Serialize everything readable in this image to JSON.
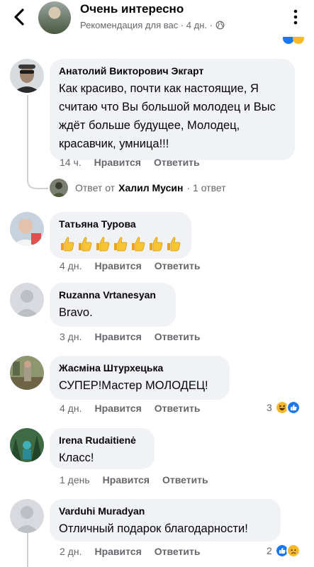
{
  "header": {
    "page_name": "Очень интересно",
    "subtitle": "Рекомендация для вас · 4 дн. ·",
    "icons": [
      "back-arrow-icon",
      "globe-icon",
      "more-dots-icon"
    ]
  },
  "comments": [
    {
      "author": "Анатолий Викторович Экгарт",
      "text": "Как красиво, почти как настоящие, Я считаю что Вы большой молодец и Выс ждёт больше будущее, Молодец, красавчик, умница!!!",
      "time": "14 ч.",
      "like": "Нравится",
      "reply": "Ответить",
      "replies": {
        "prefix": "Ответ от",
        "name": "Халил Мусин",
        "count": "· 1 ответ"
      }
    },
    {
      "author": "Татьяна Турова",
      "text": "",
      "emoji": "thumbs-up x7",
      "time": "4 дн.",
      "like": "Нравится",
      "reply": "Ответить"
    },
    {
      "author": "Ruzanna Vrtanesyan",
      "text": "Bravo.",
      "time": "3 дн.",
      "like": "Нравится",
      "reply": "Ответить"
    },
    {
      "author": "Жасміна Штурхецька",
      "text": "СУПЕР!Мастер МОЛОДЕЦ!",
      "time": "4 дн.",
      "like": "Нравится",
      "reply": "Ответить",
      "reaction_count": "3"
    },
    {
      "author": "Irena Rudaitienė",
      "text": "Класс!",
      "time": "1 день",
      "like": "Нравится",
      "reply": "Ответить"
    },
    {
      "author": "Varduhi Muradyan",
      "text": "Отличный подарок благодарности!",
      "time": "2 дн.",
      "like": "Нравится",
      "reply": "Ответить",
      "reaction_count": "2"
    }
  ],
  "colors": {
    "bubble": "#f0f2f5",
    "meta_text": "#65676b",
    "like_blue": "#1877f2",
    "haha_yellow": "#f7b928",
    "thread_line": "#ced0d4"
  }
}
